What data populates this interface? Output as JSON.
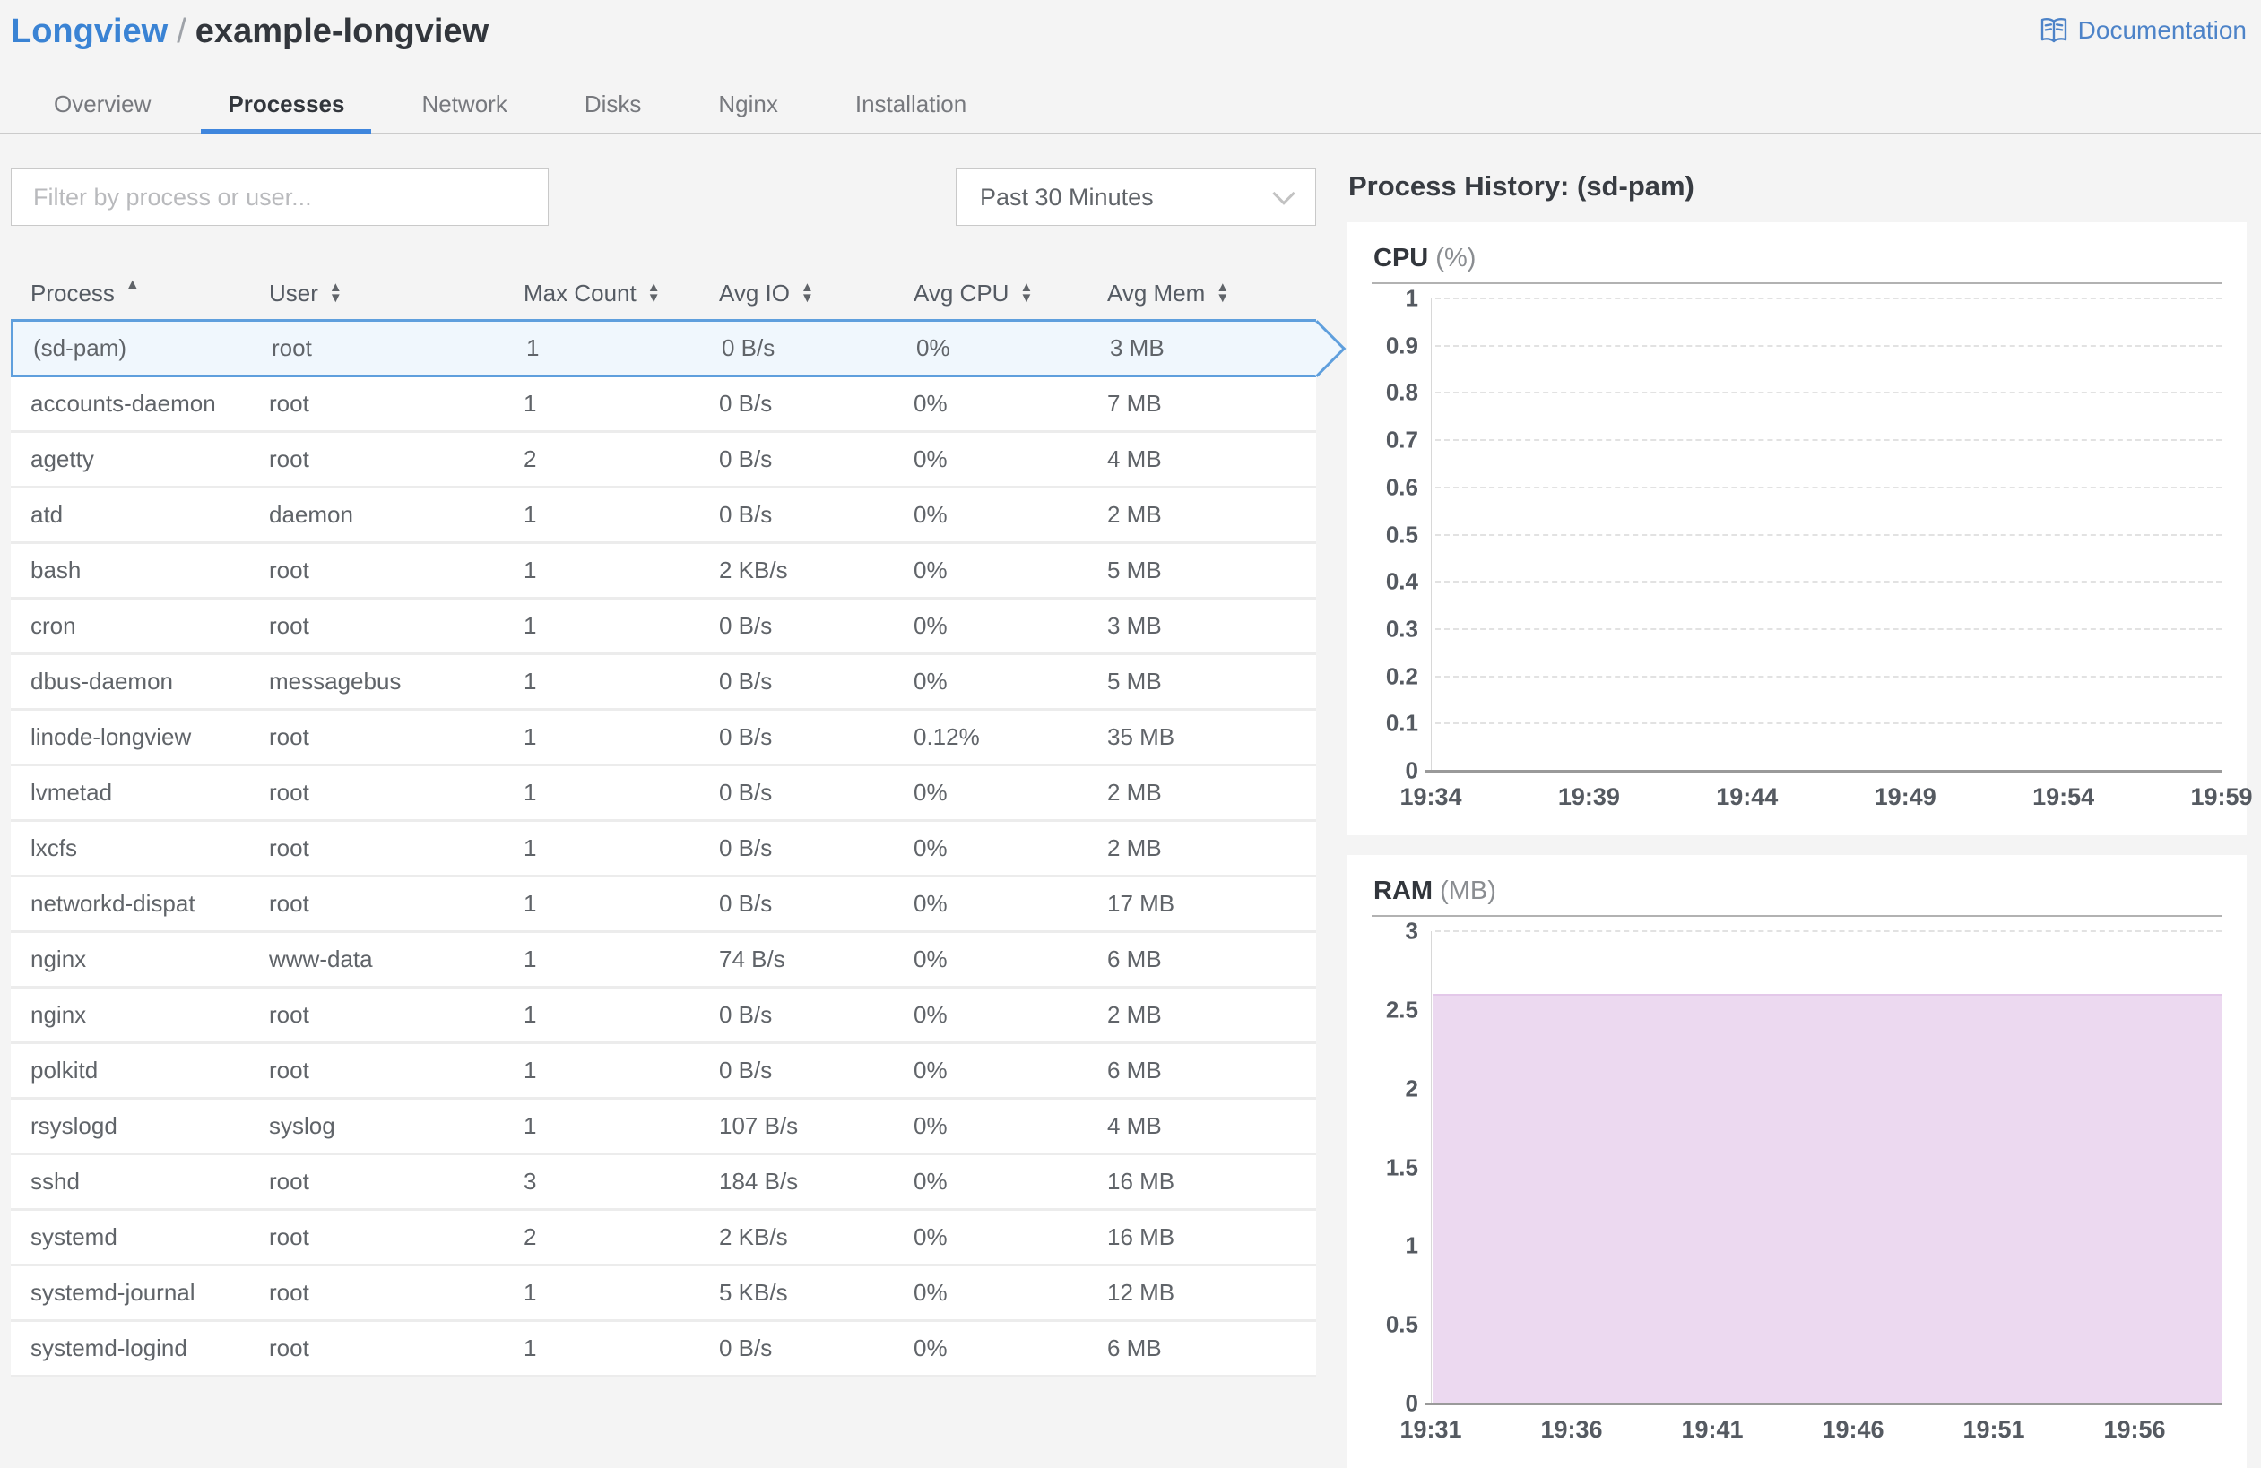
{
  "header": {
    "breadcrumb_section": "Longview",
    "breadcrumb_separator": "/",
    "breadcrumb_entity": "example-longview",
    "documentation_label": "Documentation"
  },
  "tabs": [
    {
      "label": "Overview",
      "active": false
    },
    {
      "label": "Processes",
      "active": true
    },
    {
      "label": "Network",
      "active": false
    },
    {
      "label": "Disks",
      "active": false
    },
    {
      "label": "Nginx",
      "active": false
    },
    {
      "label": "Installation",
      "active": false
    }
  ],
  "filter": {
    "placeholder": "Filter by process or user..."
  },
  "time_range": {
    "selected": "Past 30 Minutes"
  },
  "table": {
    "columns": [
      {
        "label": "Process",
        "sorted": "asc"
      },
      {
        "label": "User",
        "sorted": "none"
      },
      {
        "label": "Max Count",
        "sorted": "none"
      },
      {
        "label": "Avg IO",
        "sorted": "none"
      },
      {
        "label": "Avg CPU",
        "sorted": "none"
      },
      {
        "label": "Avg Mem",
        "sorted": "none"
      }
    ],
    "selected_index": 0,
    "rows": [
      [
        "(sd-pam)",
        "root",
        "1",
        "0 B/s",
        "0%",
        "3 MB"
      ],
      [
        "accounts-daemon",
        "root",
        "1",
        "0 B/s",
        "0%",
        "7 MB"
      ],
      [
        "agetty",
        "root",
        "2",
        "0 B/s",
        "0%",
        "4 MB"
      ],
      [
        "atd",
        "daemon",
        "1",
        "0 B/s",
        "0%",
        "2 MB"
      ],
      [
        "bash",
        "root",
        "1",
        "2 KB/s",
        "0%",
        "5 MB"
      ],
      [
        "cron",
        "root",
        "1",
        "0 B/s",
        "0%",
        "3 MB"
      ],
      [
        "dbus-daemon",
        "messagebus",
        "1",
        "0 B/s",
        "0%",
        "5 MB"
      ],
      [
        "linode-longview",
        "root",
        "1",
        "0 B/s",
        "0.12%",
        "35 MB"
      ],
      [
        "lvmetad",
        "root",
        "1",
        "0 B/s",
        "0%",
        "2 MB"
      ],
      [
        "lxcfs",
        "root",
        "1",
        "0 B/s",
        "0%",
        "2 MB"
      ],
      [
        "networkd-dispat",
        "root",
        "1",
        "0 B/s",
        "0%",
        "17 MB"
      ],
      [
        "nginx",
        "www-data",
        "1",
        "74 B/s",
        "0%",
        "6 MB"
      ],
      [
        "nginx",
        "root",
        "1",
        "0 B/s",
        "0%",
        "2 MB"
      ],
      [
        "polkitd",
        "root",
        "1",
        "0 B/s",
        "0%",
        "6 MB"
      ],
      [
        "rsyslogd",
        "syslog",
        "1",
        "107 B/s",
        "0%",
        "4 MB"
      ],
      [
        "sshd",
        "root",
        "3",
        "184 B/s",
        "0%",
        "16 MB"
      ],
      [
        "systemd",
        "root",
        "2",
        "2 KB/s",
        "0%",
        "16 MB"
      ],
      [
        "systemd-journal",
        "root",
        "1",
        "5 KB/s",
        "0%",
        "12 MB"
      ],
      [
        "systemd-logind",
        "root",
        "1",
        "0 B/s",
        "0%",
        "6 MB"
      ]
    ]
  },
  "process_history": {
    "title": "Process History: (sd-pam)"
  },
  "chart_data": [
    {
      "id": "cpu",
      "type": "line",
      "title": "CPU",
      "unit": "(%)",
      "ylim": [
        0,
        1
      ],
      "y_ticks": [
        "1",
        "0.9",
        "0.8",
        "0.7",
        "0.6",
        "0.5",
        "0.4",
        "0.3",
        "0.2",
        "0.1",
        "0"
      ],
      "x_ticks": [
        "19:34",
        "19:39",
        "19:44",
        "19:49",
        "19:54",
        "19:59"
      ],
      "x_spread_pct": 100,
      "grid": "dashed-horizontal",
      "series": [
        {
          "name": "CPU",
          "values": [
            0,
            0,
            0,
            0,
            0,
            0
          ]
        }
      ]
    },
    {
      "id": "ram",
      "type": "area",
      "title": "RAM",
      "unit": "(MB)",
      "ylim": [
        0,
        3
      ],
      "y_ticks": [
        "3",
        "2.5",
        "2",
        "1.5",
        "1",
        "0.5",
        "0"
      ],
      "x_ticks": [
        "19:31",
        "19:36",
        "19:41",
        "19:46",
        "19:51",
        "19:56"
      ],
      "x_spread_pct": 89,
      "grid": "dashed-horizontal",
      "fill_color": "#ecd9f0",
      "series": [
        {
          "name": "RAM",
          "values": [
            2.6,
            2.6,
            2.6,
            2.6,
            2.6,
            2.6
          ]
        }
      ]
    }
  ],
  "colors": {
    "accent_blue": "#3a83d4",
    "tab_underline": "#3f86dd",
    "selected_row_border": "#5f9fdd",
    "selected_row_bg": "#f0f7fd",
    "ram_fill": "#ecd9f0",
    "page_bg": "#f4f4f4"
  }
}
